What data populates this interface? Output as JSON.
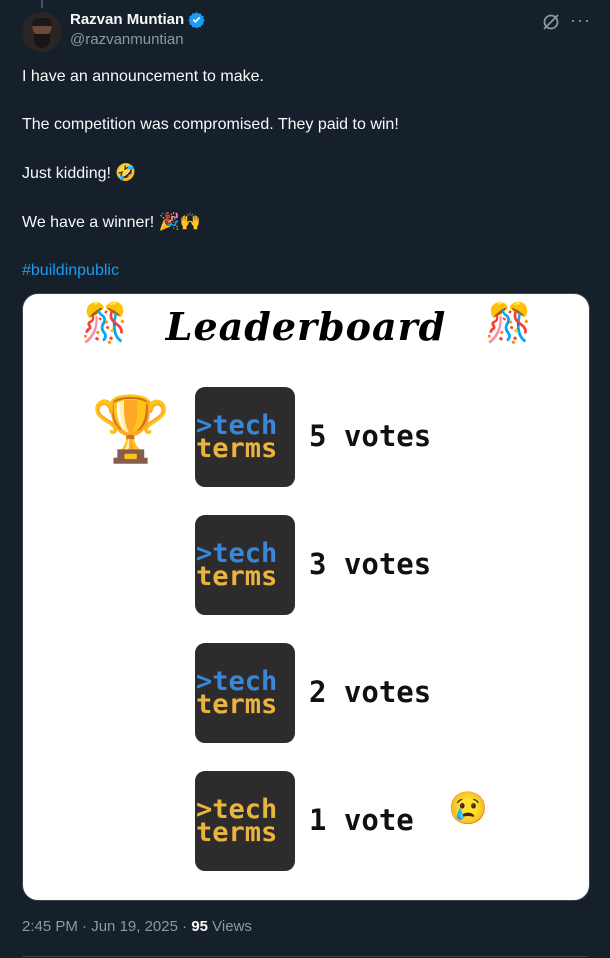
{
  "author": {
    "display_name": "Razvan Muntian",
    "handle": "@razvanmuntian"
  },
  "icons": {
    "verified": "verified-badge-icon",
    "grok": "grok-icon",
    "more": "more-icon"
  },
  "tweet": {
    "line1": "I have an announcement to make.",
    "line2": "The competition was compromised. They paid to win!",
    "line3": "Just kidding!",
    "line3_emoji": "🤣",
    "line4": "We have a winner!",
    "line4_emoji": "🎉🙌",
    "hashtag": "#buildinpublic"
  },
  "media": {
    "title": "Leaderboard",
    "confetti_emoji": "🎊",
    "trophy_emoji": "🏆",
    "cry_emoji": "😢",
    "logo_line1": ">tech",
    "logo_line2": "terms",
    "entries": [
      {
        "votes": "5 votes"
      },
      {
        "votes": "3 votes"
      },
      {
        "votes": "2 votes"
      },
      {
        "votes": "1 vote"
      }
    ]
  },
  "meta": {
    "time": "2:45 PM",
    "date": "Jun 19, 2025",
    "views_count": "95",
    "views_label": "Views"
  },
  "colors": {
    "background": "#15202b",
    "link": "#1d9bf0",
    "muted": "#8b98a5",
    "logo_blue": "#3a86d8",
    "logo_yellow": "#e8b53d"
  }
}
